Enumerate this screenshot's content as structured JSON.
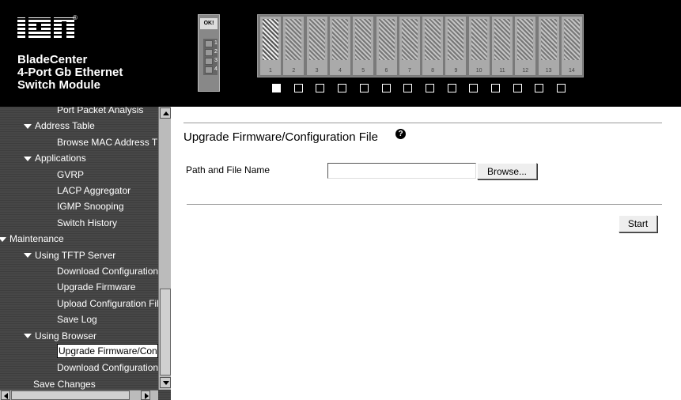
{
  "header": {
    "logo_text": "IBM",
    "product_lines": [
      "BladeCenter",
      "4-Port Gb Ethernet",
      "Switch Module"
    ],
    "status_label": "OK!",
    "port_numbers": [
      "1",
      "2",
      "3",
      "4"
    ],
    "bays": [
      "1",
      "2",
      "3",
      "4",
      "5",
      "6",
      "7",
      "8",
      "9",
      "10",
      "11",
      "12",
      "13",
      "14"
    ],
    "selected_bay": 1
  },
  "sidebar": {
    "items": [
      {
        "label": "Port Packet Analysis",
        "level": 3,
        "expanded": false
      },
      {
        "label": "Address Table",
        "level": 2,
        "expanded": true
      },
      {
        "label": "Browse MAC Address T",
        "level": 3,
        "expanded": false
      },
      {
        "label": "Applications",
        "level": 2,
        "expanded": true
      },
      {
        "label": "GVRP",
        "level": 3,
        "expanded": false
      },
      {
        "label": "LACP Aggregator",
        "level": 3,
        "expanded": false
      },
      {
        "label": "IGMP Snooping",
        "level": 3,
        "expanded": false
      },
      {
        "label": "Switch History",
        "level": 3,
        "expanded": false
      },
      {
        "label": "Maintenance",
        "level": 1,
        "expanded": true
      },
      {
        "label": "Using TFTP Server",
        "level": 2,
        "expanded": true
      },
      {
        "label": "Download Configuration",
        "level": 3,
        "expanded": false
      },
      {
        "label": "Upgrade Firmware",
        "level": 3,
        "expanded": false
      },
      {
        "label": "Upload Configuration Fil",
        "level": 3,
        "expanded": false
      },
      {
        "label": "Save Log",
        "level": 3,
        "expanded": false
      },
      {
        "label": "Using Browser",
        "level": 2,
        "expanded": true
      },
      {
        "label": "Upgrade Firmware/Conf",
        "level": 3,
        "expanded": false,
        "active": true
      },
      {
        "label": "Download Configuration",
        "level": 3,
        "expanded": false
      },
      {
        "label": "Save Changes",
        "level": 2,
        "expanded": false
      }
    ]
  },
  "main": {
    "title": "Upgrade Firmware/Configuration File",
    "help_glyph": "?",
    "path_label": "Path and File Name",
    "file_value": "",
    "browse_label": "Browse...",
    "start_label": "Start"
  }
}
